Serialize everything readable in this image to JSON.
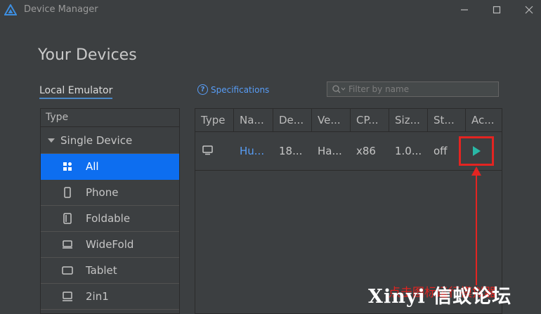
{
  "window": {
    "title": "Device Manager",
    "logo_icon": "triangle-logo-icon",
    "controls": [
      "minimize-icon",
      "maximize-icon",
      "close-icon"
    ]
  },
  "page": {
    "heading": "Your Devices",
    "tab_local": "Local Emulator",
    "spec_link": "Specifications",
    "filter_placeholder": "Filter by name"
  },
  "left_panel": {
    "header": "Type",
    "group": "Single Device",
    "items": [
      {
        "label": "All",
        "icon": "grid-icon",
        "active": true
      },
      {
        "label": "Phone",
        "icon": "phone-icon",
        "active": false
      },
      {
        "label": "Foldable",
        "icon": "foldable-icon",
        "active": false
      },
      {
        "label": "WideFold",
        "icon": "widefold-icon",
        "active": false
      },
      {
        "label": "Tablet",
        "icon": "tablet-icon",
        "active": false
      },
      {
        "label": "2in1",
        "icon": "laptop-icon",
        "active": false
      }
    ]
  },
  "table": {
    "columns": [
      "Type",
      "Na...",
      "De...",
      "Ve...",
      "CP...",
      "Siz...",
      "St...",
      "Ac..."
    ],
    "rows": [
      {
        "type_icon": "monitor-icon",
        "name": "Hu...",
        "device": "18...",
        "version": "Ha...",
        "cpu": "x86",
        "size": "1.0...",
        "status": "off",
        "action_icon": "play-icon"
      }
    ]
  },
  "annotation": {
    "watermark": "Xinyi 信蚁论坛",
    "red_caption": "点击图标运行模拟器",
    "highlight_color": "#e32421"
  },
  "colors": {
    "background": "#3c3f41",
    "accent": "#0d6ef0",
    "link": "#589df6",
    "play": "#29b8a6"
  }
}
